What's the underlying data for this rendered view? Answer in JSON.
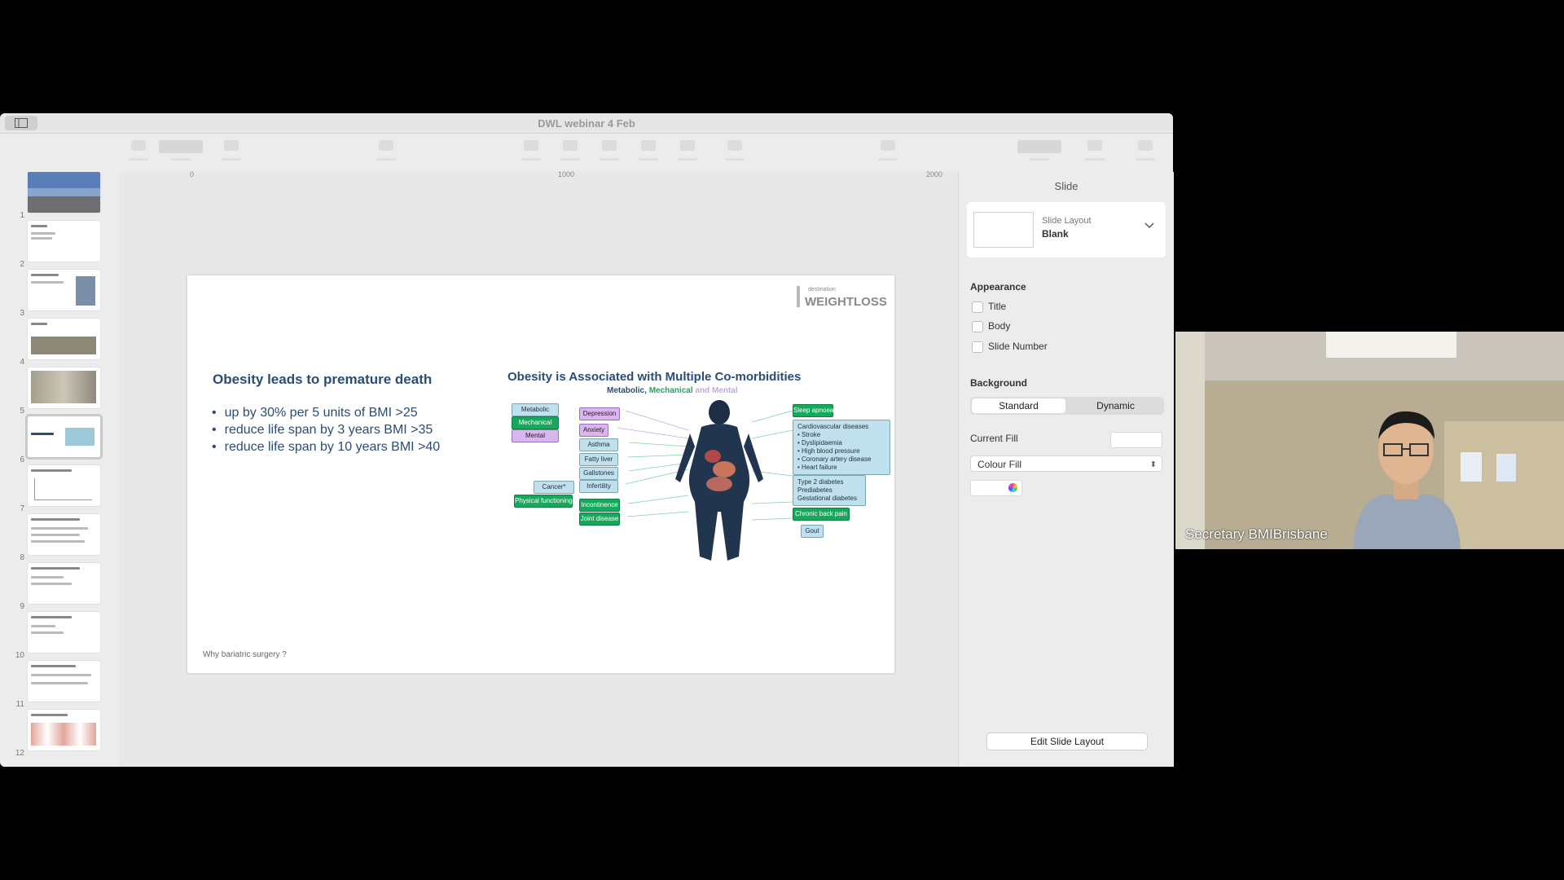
{
  "window": {
    "title": "DWL webinar 4 Feb"
  },
  "thumbnails": [
    {
      "num": "1"
    },
    {
      "num": "2"
    },
    {
      "num": "3"
    },
    {
      "num": "4"
    },
    {
      "num": "5"
    },
    {
      "num": "6"
    },
    {
      "num": "7"
    },
    {
      "num": "8"
    },
    {
      "num": "9"
    },
    {
      "num": "10"
    },
    {
      "num": "11"
    },
    {
      "num": "12"
    }
  ],
  "ruler": {
    "marks": [
      "0",
      "1000",
      "2000"
    ]
  },
  "slide": {
    "logo_small": "destination",
    "logo_text": "WEIGHTLOSS",
    "left_title": "Obesity leads to premature death",
    "bullets": [
      "up by 30% per 5 units of BMI >25",
      "reduce life span by 3 years BMI >35",
      "reduce life span by 10 years BMI >40"
    ],
    "right_title": "Obesity is Associated with Multiple Co-morbidities",
    "subtitle": {
      "part1": "Metabolic, ",
      "part2": "Mechanical",
      "part3": " and Mental"
    },
    "diagram": {
      "metabolic": "Metabolic",
      "mechanical": "Mechanical",
      "mental": "Mental",
      "depression": "Depression",
      "anxiety": "Anxiety",
      "asthma": "Asthma",
      "fatty_liver": "Fatty liver",
      "gallstones": "Gallstones",
      "infertility": "Infertility",
      "cancer": "Cancer*",
      "physical": "Physical functioning",
      "incontinence": "Incontinence",
      "joint": "Joint disease",
      "sleep": "Sleep apnoea",
      "cardio": [
        "Cardiovascular diseases",
        "• Stroke",
        "• Dyslipidaemia",
        "• High blood pressure",
        "• Coronary artery disease",
        "• Heart failure"
      ],
      "diabetes": [
        "Type 2 diabetes",
        "Prediabetes",
        "Gestational diabetes"
      ],
      "back_pain": "Chronic back pain",
      "gout": "Gout"
    },
    "footer": "Why bariatric surgery ?"
  },
  "inspector": {
    "tab": "Slide",
    "layout_caption": "Slide Layout",
    "layout_value": "Blank",
    "appearance": "Appearance",
    "title_opt": "Title",
    "body_opt": "Body",
    "slide_number_opt": "Slide Number",
    "background": "Background",
    "standard": "Standard",
    "dynamic": "Dynamic",
    "current_fill": "Current Fill",
    "fill_type": "Colour Fill",
    "edit_layout": "Edit Slide Layout"
  },
  "video": {
    "participant": "Secretary BMIBrisbane"
  },
  "colors": {
    "title_blue": "#2b4c76",
    "green": "#16a95b",
    "purple": "#b58ad8"
  }
}
